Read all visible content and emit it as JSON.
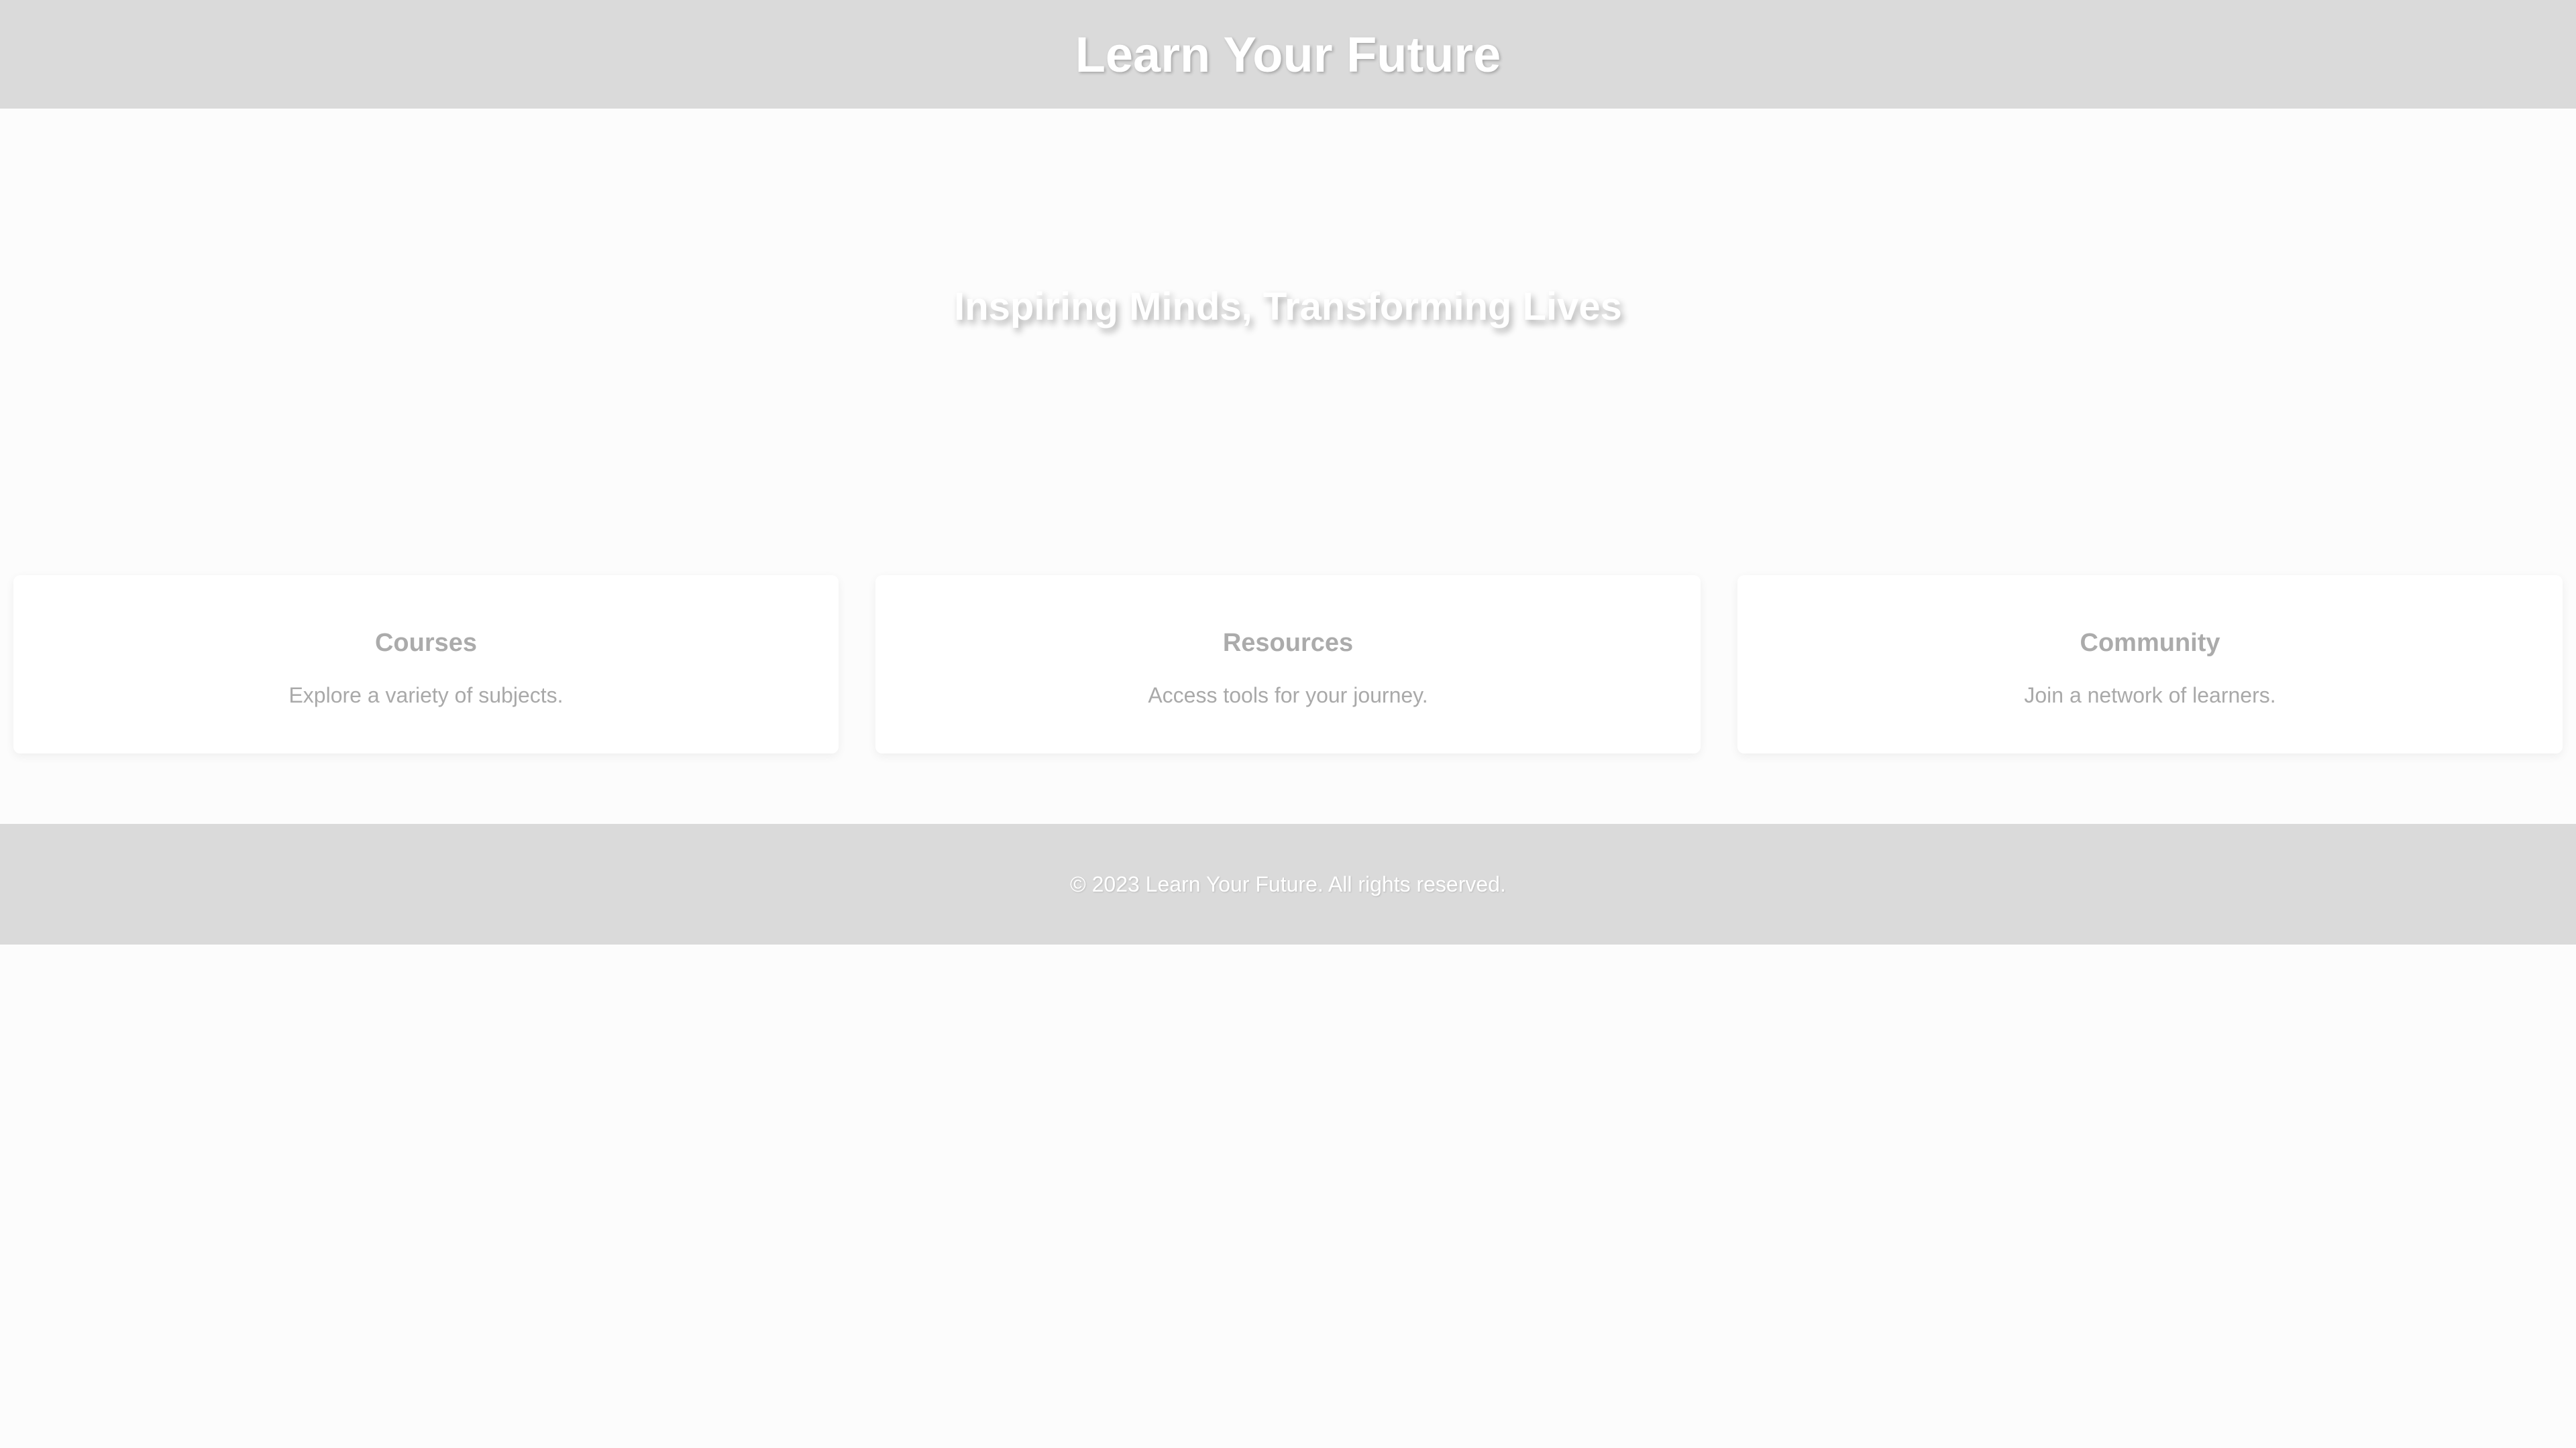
{
  "header": {
    "title": "Learn Your Future"
  },
  "hero": {
    "tagline": "Inspiring Minds, Transforming Lives"
  },
  "features": [
    {
      "title": "Courses",
      "description": "Explore a variety of subjects."
    },
    {
      "title": "Resources",
      "description": "Access tools for your journey."
    },
    {
      "title": "Community",
      "description": "Join a network of learners."
    }
  ],
  "footer": {
    "copyright": "© 2023 Learn Your Future. All rights reserved."
  },
  "colors": {
    "header_bg": "#dadada",
    "page_bg": "#fcfcfc",
    "card_bg": "#ffffff",
    "card_text": "#ababab",
    "header_text": "#ffffff"
  }
}
